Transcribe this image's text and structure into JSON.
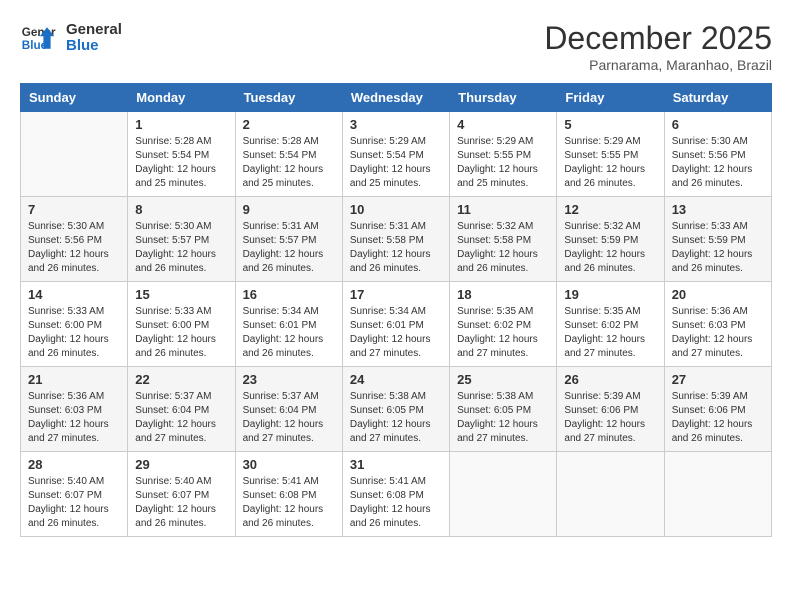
{
  "header": {
    "logo_line1": "General",
    "logo_line2": "Blue",
    "title": "December 2025",
    "subtitle": "Parnarama, Maranhao, Brazil"
  },
  "columns": [
    "Sunday",
    "Monday",
    "Tuesday",
    "Wednesday",
    "Thursday",
    "Friday",
    "Saturday"
  ],
  "weeks": [
    [
      {
        "day": "",
        "info": ""
      },
      {
        "day": "1",
        "info": "Sunrise: 5:28 AM\nSunset: 5:54 PM\nDaylight: 12 hours\nand 25 minutes."
      },
      {
        "day": "2",
        "info": "Sunrise: 5:28 AM\nSunset: 5:54 PM\nDaylight: 12 hours\nand 25 minutes."
      },
      {
        "day": "3",
        "info": "Sunrise: 5:29 AM\nSunset: 5:54 PM\nDaylight: 12 hours\nand 25 minutes."
      },
      {
        "day": "4",
        "info": "Sunrise: 5:29 AM\nSunset: 5:55 PM\nDaylight: 12 hours\nand 25 minutes."
      },
      {
        "day": "5",
        "info": "Sunrise: 5:29 AM\nSunset: 5:55 PM\nDaylight: 12 hours\nand 26 minutes."
      },
      {
        "day": "6",
        "info": "Sunrise: 5:30 AM\nSunset: 5:56 PM\nDaylight: 12 hours\nand 26 minutes."
      }
    ],
    [
      {
        "day": "7",
        "info": "Sunrise: 5:30 AM\nSunset: 5:56 PM\nDaylight: 12 hours\nand 26 minutes."
      },
      {
        "day": "8",
        "info": "Sunrise: 5:30 AM\nSunset: 5:57 PM\nDaylight: 12 hours\nand 26 minutes."
      },
      {
        "day": "9",
        "info": "Sunrise: 5:31 AM\nSunset: 5:57 PM\nDaylight: 12 hours\nand 26 minutes."
      },
      {
        "day": "10",
        "info": "Sunrise: 5:31 AM\nSunset: 5:58 PM\nDaylight: 12 hours\nand 26 minutes."
      },
      {
        "day": "11",
        "info": "Sunrise: 5:32 AM\nSunset: 5:58 PM\nDaylight: 12 hours\nand 26 minutes."
      },
      {
        "day": "12",
        "info": "Sunrise: 5:32 AM\nSunset: 5:59 PM\nDaylight: 12 hours\nand 26 minutes."
      },
      {
        "day": "13",
        "info": "Sunrise: 5:33 AM\nSunset: 5:59 PM\nDaylight: 12 hours\nand 26 minutes."
      }
    ],
    [
      {
        "day": "14",
        "info": "Sunrise: 5:33 AM\nSunset: 6:00 PM\nDaylight: 12 hours\nand 26 minutes."
      },
      {
        "day": "15",
        "info": "Sunrise: 5:33 AM\nSunset: 6:00 PM\nDaylight: 12 hours\nand 26 minutes."
      },
      {
        "day": "16",
        "info": "Sunrise: 5:34 AM\nSunset: 6:01 PM\nDaylight: 12 hours\nand 26 minutes."
      },
      {
        "day": "17",
        "info": "Sunrise: 5:34 AM\nSunset: 6:01 PM\nDaylight: 12 hours\nand 27 minutes."
      },
      {
        "day": "18",
        "info": "Sunrise: 5:35 AM\nSunset: 6:02 PM\nDaylight: 12 hours\nand 27 minutes."
      },
      {
        "day": "19",
        "info": "Sunrise: 5:35 AM\nSunset: 6:02 PM\nDaylight: 12 hours\nand 27 minutes."
      },
      {
        "day": "20",
        "info": "Sunrise: 5:36 AM\nSunset: 6:03 PM\nDaylight: 12 hours\nand 27 minutes."
      }
    ],
    [
      {
        "day": "21",
        "info": "Sunrise: 5:36 AM\nSunset: 6:03 PM\nDaylight: 12 hours\nand 27 minutes."
      },
      {
        "day": "22",
        "info": "Sunrise: 5:37 AM\nSunset: 6:04 PM\nDaylight: 12 hours\nand 27 minutes."
      },
      {
        "day": "23",
        "info": "Sunrise: 5:37 AM\nSunset: 6:04 PM\nDaylight: 12 hours\nand 27 minutes."
      },
      {
        "day": "24",
        "info": "Sunrise: 5:38 AM\nSunset: 6:05 PM\nDaylight: 12 hours\nand 27 minutes."
      },
      {
        "day": "25",
        "info": "Sunrise: 5:38 AM\nSunset: 6:05 PM\nDaylight: 12 hours\nand 27 minutes."
      },
      {
        "day": "26",
        "info": "Sunrise: 5:39 AM\nSunset: 6:06 PM\nDaylight: 12 hours\nand 27 minutes."
      },
      {
        "day": "27",
        "info": "Sunrise: 5:39 AM\nSunset: 6:06 PM\nDaylight: 12 hours\nand 26 minutes."
      }
    ],
    [
      {
        "day": "28",
        "info": "Sunrise: 5:40 AM\nSunset: 6:07 PM\nDaylight: 12 hours\nand 26 minutes."
      },
      {
        "day": "29",
        "info": "Sunrise: 5:40 AM\nSunset: 6:07 PM\nDaylight: 12 hours\nand 26 minutes."
      },
      {
        "day": "30",
        "info": "Sunrise: 5:41 AM\nSunset: 6:08 PM\nDaylight: 12 hours\nand 26 minutes."
      },
      {
        "day": "31",
        "info": "Sunrise: 5:41 AM\nSunset: 6:08 PM\nDaylight: 12 hours\nand 26 minutes."
      },
      {
        "day": "",
        "info": ""
      },
      {
        "day": "",
        "info": ""
      },
      {
        "day": "",
        "info": ""
      }
    ]
  ]
}
